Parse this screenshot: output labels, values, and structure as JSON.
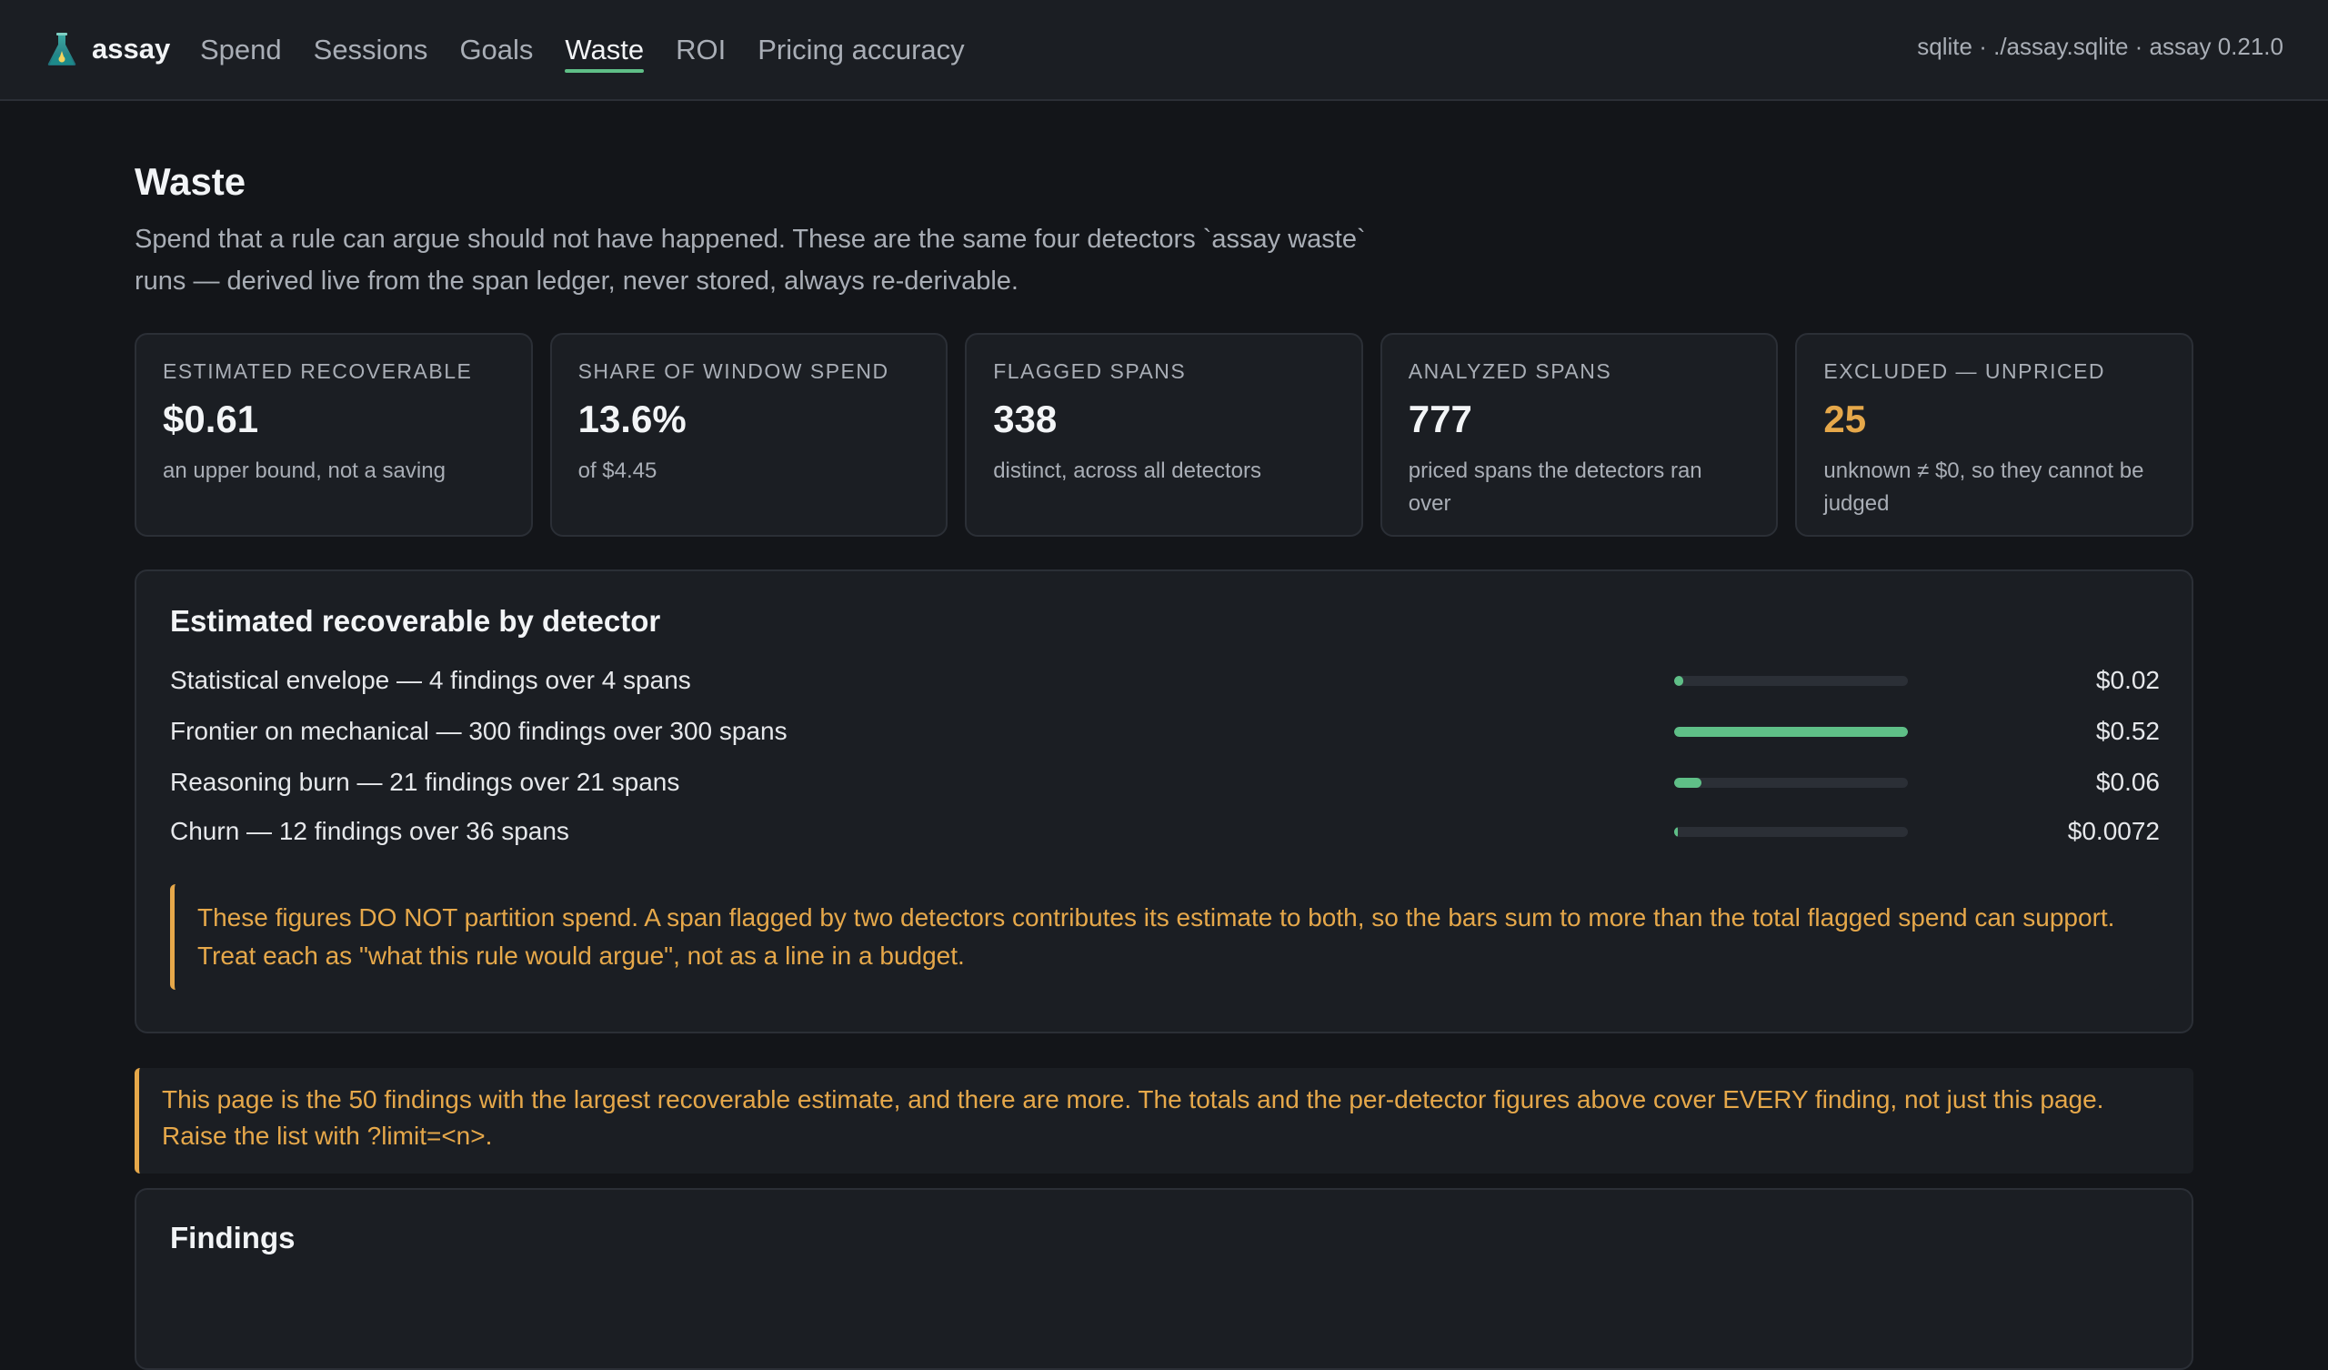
{
  "app": {
    "name": "assay",
    "env": "sqlite · ./assay.sqlite · assay 0.21.0"
  },
  "nav": {
    "items": [
      {
        "label": "Spend",
        "active": false
      },
      {
        "label": "Sessions",
        "active": false
      },
      {
        "label": "Goals",
        "active": false
      },
      {
        "label": "Waste",
        "active": true
      },
      {
        "label": "ROI",
        "active": false
      },
      {
        "label": "Pricing accuracy",
        "active": false
      }
    ]
  },
  "page": {
    "title": "Waste",
    "description": "Spend that a rule can argue should not have happened. These are the same four detectors `assay waste` runs — derived live from the span ledger, never stored, always re-derivable."
  },
  "stats": [
    {
      "label": "Estimated recoverable",
      "value": "$0.61",
      "note": "an upper bound, not a saving",
      "warn": false
    },
    {
      "label": "Share of window spend",
      "value": "13.6%",
      "note": "of $4.45",
      "warn": false
    },
    {
      "label": "Flagged spans",
      "value": "338",
      "note": "distinct, across all detectors",
      "warn": false
    },
    {
      "label": "Analyzed spans",
      "value": "777",
      "note": "priced spans the detectors ran over",
      "warn": false
    },
    {
      "label": "Excluded — unpriced",
      "value": "25",
      "note": "unknown ≠ $0, so they cannot be judged",
      "warn": true
    }
  ],
  "detectors": {
    "title": "Estimated recoverable by detector",
    "rows": [
      {
        "label": "Statistical envelope — 4 findings over 4 spans",
        "value": "$0.02",
        "share": 0.038
      },
      {
        "label": "Frontier on mechanical — 300 findings over 300 spans",
        "value": "$0.52",
        "share": 1.0
      },
      {
        "label": "Reasoning burn — 21 findings over 21 spans",
        "value": "$0.06",
        "share": 0.115
      },
      {
        "label": "Churn — 12 findings over 36 spans",
        "value": "$0.0072",
        "share": 0.014
      }
    ],
    "callout": "These figures DO NOT partition spend. A span flagged by two detectors contributes its estimate to both, so the bars sum to more than the total flagged spend can support. Treat each as \"what this rule would argue\", not as a line in a budget."
  },
  "page_note": "This page is the 50 findings with the largest recoverable estimate, and there are more. The totals and the per-detector figures above cover EVERY finding, not just this page. Raise the list with ?limit=<n>.",
  "findings": {
    "title": "Findings"
  },
  "colors": {
    "accent": "#5fbf87",
    "warning": "#e6a84a",
    "background": "#131519",
    "surface": "#1b1e23"
  },
  "icons": {
    "brand": "flask-icon"
  }
}
